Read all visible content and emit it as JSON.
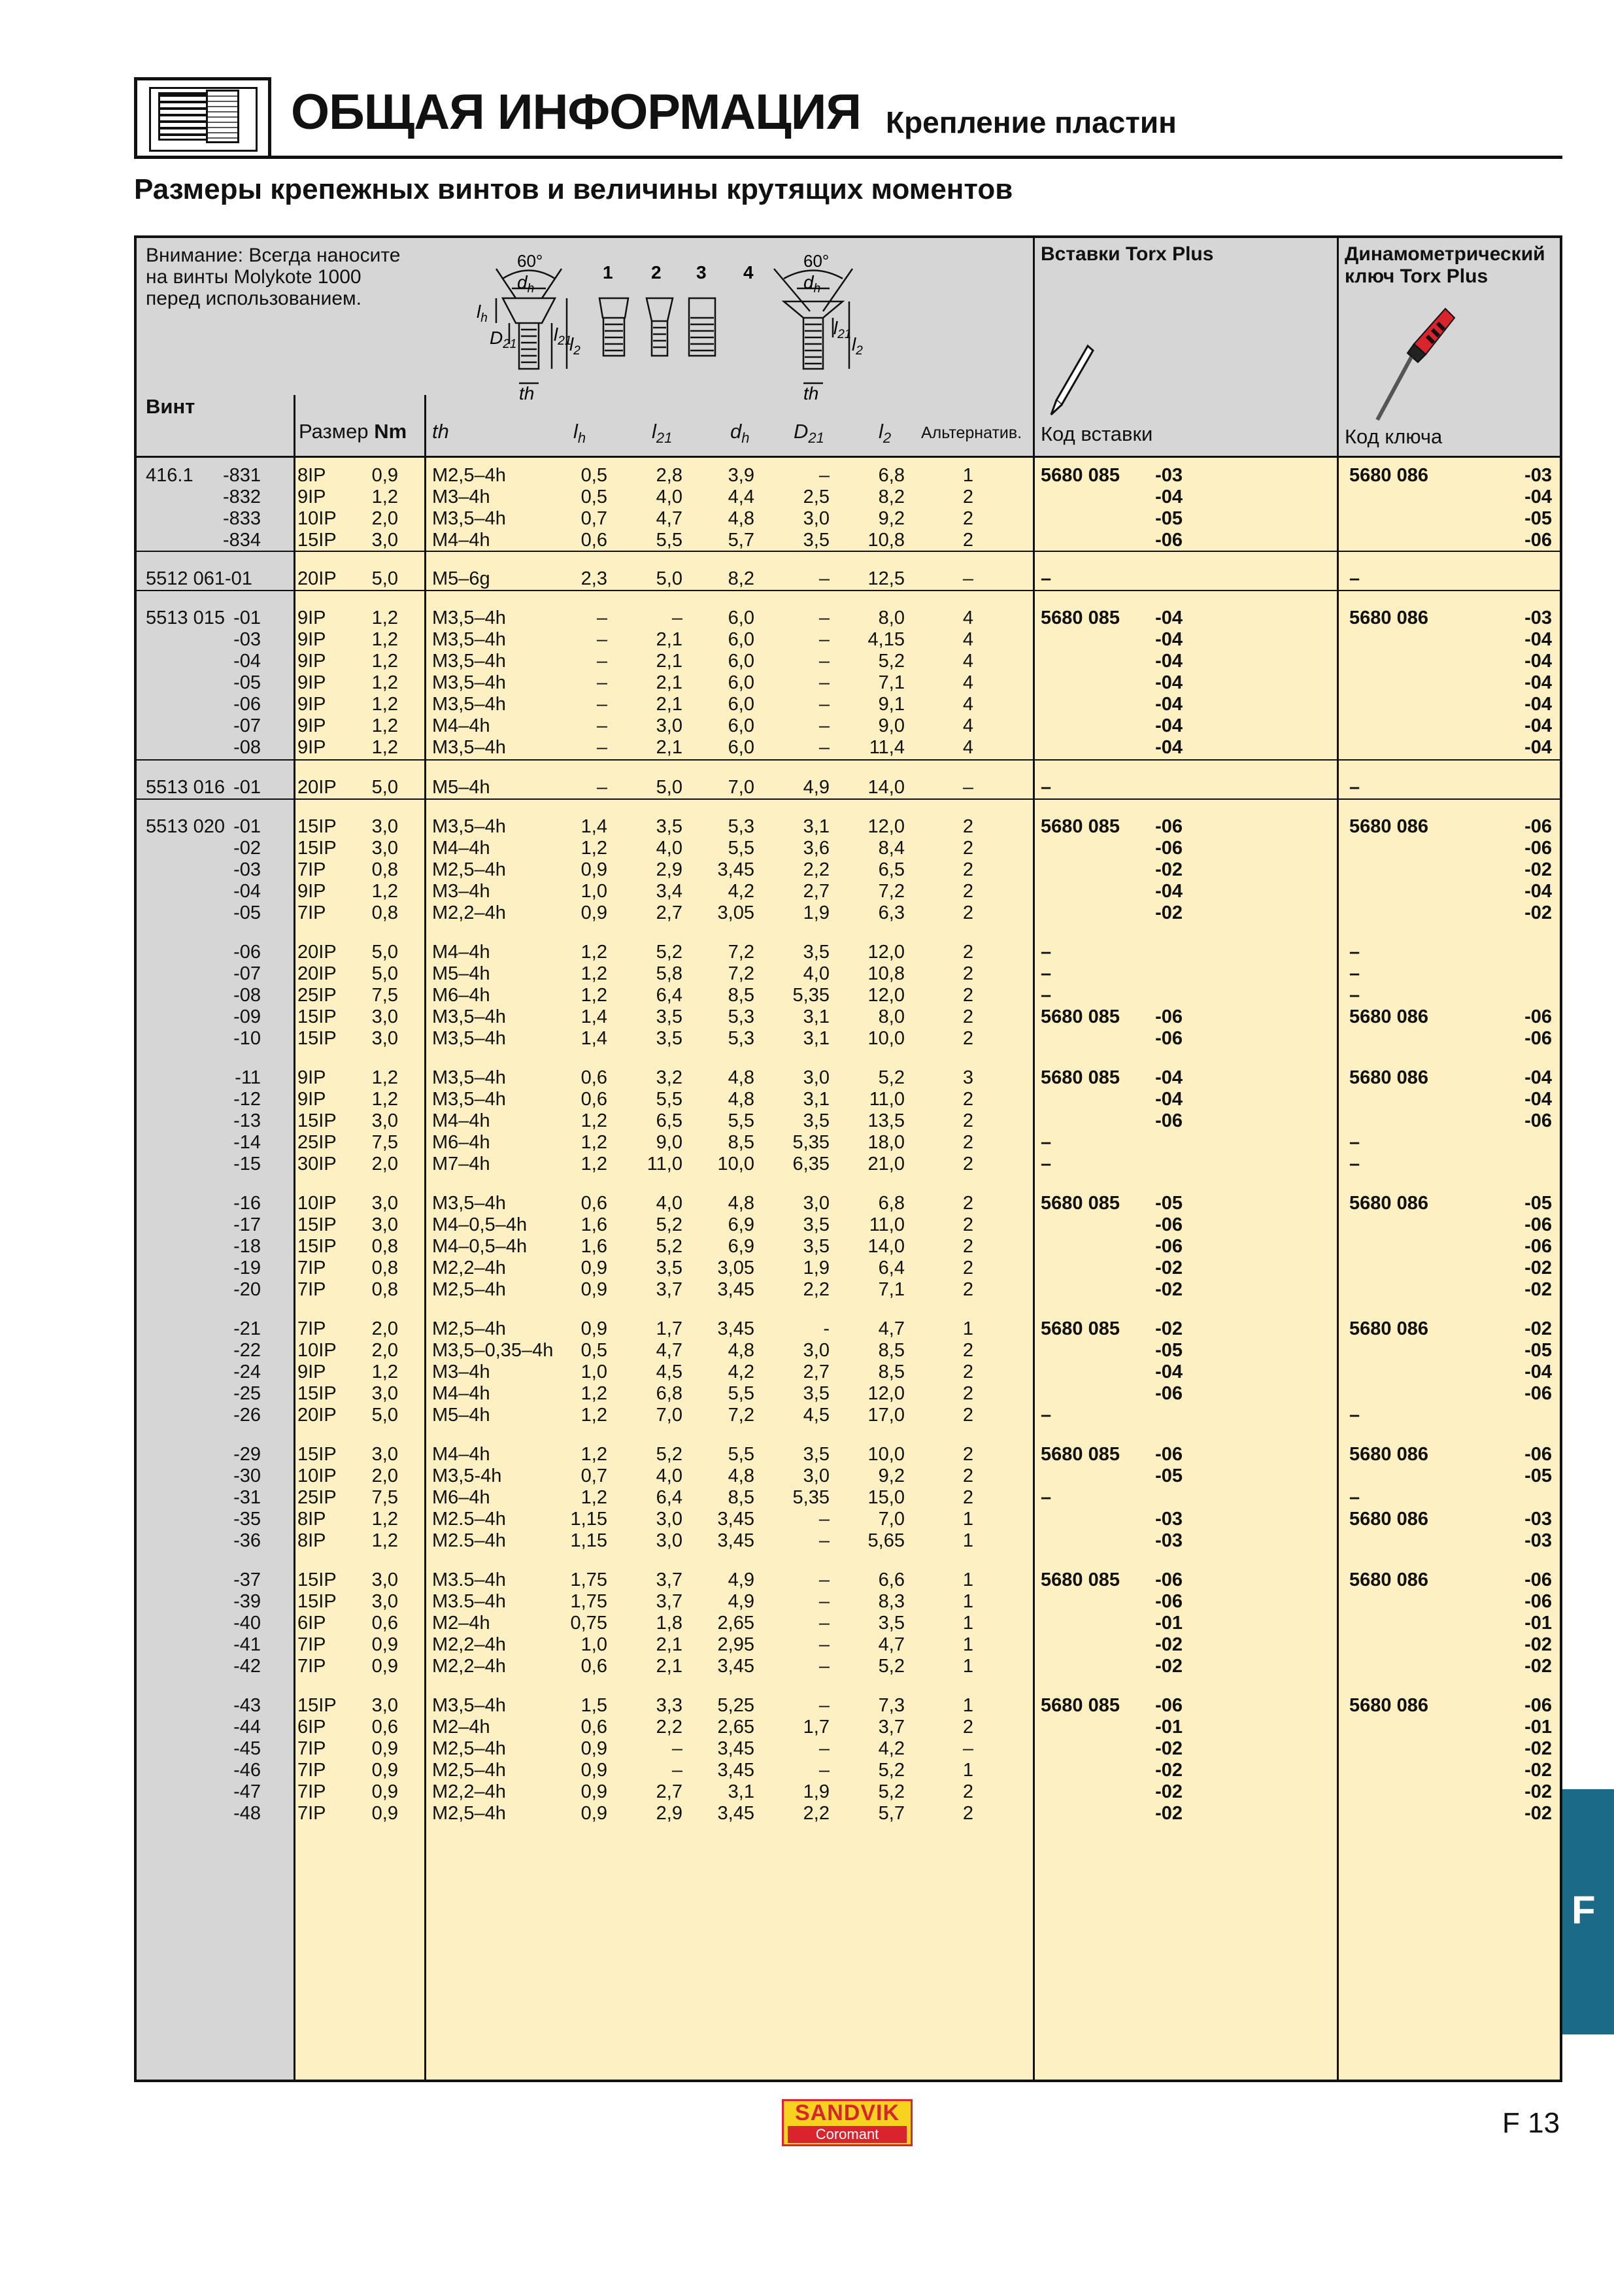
{
  "header": {
    "title": "ОБЩАЯ ИНФОРМАЦИЯ",
    "subtitle": "Крепление пластин"
  },
  "section_title": "Размеры крепежных винтов и величины крутящих моментов",
  "table_head": {
    "note": [
      "Внимание: Всегда наносите",
      "на винты Molykote 1000",
      "перед использованием."
    ],
    "screw": "Винт",
    "size": "Размер",
    "nm": "Nm",
    "th": "th",
    "lh": "l",
    "lh_sub": "h",
    "l21": "l",
    "l21_sub": "21",
    "dh": "d",
    "dh_sub": "h",
    "d21": "D",
    "d21_sub": "21",
    "l2": "l",
    "l2_sub": "2",
    "alt": "Альтернатив.",
    "torx_inserts": "Вставки Torx Plus",
    "torque_key": [
      "Динамометрический",
      "ключ Torx Plus"
    ],
    "insert_code": "Код вставки",
    "key_code": "Код ключа",
    "diagram": {
      "angle": "60°",
      "type_numbers": [
        "1",
        "2",
        "3",
        "4"
      ],
      "lbl_dh": "d",
      "lbl_dh_sub": "h",
      "lbl_lh": "l",
      "lbl_lh_sub": "h",
      "lbl_D21": "D",
      "lbl_D21_sub": "21",
      "lbl_l21": "l",
      "lbl_l21_sub": "21",
      "lbl_l2": "l",
      "lbl_l2_sub": "2",
      "lbl_th": "th"
    }
  },
  "rows": [
    [
      "416.1",
      "-831",
      "8IP",
      "0,9",
      "M2,5–4h",
      "0,5",
      "2,8",
      "3,9",
      "–",
      "6,8",
      "1",
      "5680 085",
      "-03",
      "5680 086",
      "-03"
    ],
    [
      "",
      "-832",
      "9IP",
      "1,2",
      "M3–4h",
      "0,5",
      "4,0",
      "4,4",
      "2,5",
      "8,2",
      "2",
      "",
      "-04",
      "",
      "-04"
    ],
    [
      "",
      "-833",
      "10IP",
      "2,0",
      "M3,5–4h",
      "0,7",
      "4,7",
      "4,8",
      "3,0",
      "9,2",
      "2",
      "",
      "-05",
      "",
      "-05"
    ],
    [
      "",
      "-834",
      "15IP",
      "3,0",
      "M4–4h",
      "0,6",
      "5,5",
      "5,7",
      "3,5",
      "10,8",
      "2",
      "",
      "-06",
      "",
      "-06"
    ],
    [
      "5512 061-01",
      "",
      "20IP",
      "5,0",
      "M5–6g",
      "2,3",
      "5,0",
      "8,2",
      "–",
      "12,5",
      "–",
      "–",
      "",
      "–",
      ""
    ],
    [
      "5513 015",
      "-01",
      "9IP",
      "1,2",
      "M3,5–4h",
      "–",
      "–",
      "6,0",
      "–",
      "8,0",
      "4",
      "5680 085",
      "-04",
      "5680 086",
      "-03"
    ],
    [
      "",
      "-03",
      "9IP",
      "1,2",
      "M3,5–4h",
      "–",
      "2,1",
      "6,0",
      "–",
      "4,15",
      "4",
      "",
      "-04",
      "",
      "-04"
    ],
    [
      "",
      "-04",
      "9IP",
      "1,2",
      "M3,5–4h",
      "–",
      "2,1",
      "6,0",
      "–",
      "5,2",
      "4",
      "",
      "-04",
      "",
      "-04"
    ],
    [
      "",
      "-05",
      "9IP",
      "1,2",
      "M3,5–4h",
      "–",
      "2,1",
      "6,0",
      "–",
      "7,1",
      "4",
      "",
      "-04",
      "",
      "-04"
    ],
    [
      "",
      "-06",
      "9IP",
      "1,2",
      "M3,5–4h",
      "–",
      "2,1",
      "6,0",
      "–",
      "9,1",
      "4",
      "",
      "-04",
      "",
      "-04"
    ],
    [
      "",
      "-07",
      "9IP",
      "1,2",
      "M4–4h",
      "–",
      "3,0",
      "6,0",
      "–",
      "9,0",
      "4",
      "",
      "-04",
      "",
      "-04"
    ],
    [
      "",
      "-08",
      "9IP",
      "1,2",
      "M3,5–4h",
      "–",
      "2,1",
      "6,0",
      "–",
      "11,4",
      "4",
      "",
      "-04",
      "",
      "-04"
    ],
    [
      "5513 016",
      "-01",
      "20IP",
      "5,0",
      "M5–4h",
      "–",
      "5,0",
      "7,0",
      "4,9",
      "14,0",
      "–",
      "–",
      "",
      "–",
      ""
    ],
    [
      "5513 020",
      "-01",
      "15IP",
      "3,0",
      "M3,5–4h",
      "1,4",
      "3,5",
      "5,3",
      "3,1",
      "12,0",
      "2",
      "5680 085",
      "-06",
      "5680 086",
      "-06"
    ],
    [
      "",
      "-02",
      "15IP",
      "3,0",
      "M4–4h",
      "1,2",
      "4,0",
      "5,5",
      "3,6",
      "8,4",
      "2",
      "",
      "-06",
      "",
      "-06"
    ],
    [
      "",
      "-03",
      "7IP",
      "0,8",
      "M2,5–4h",
      "0,9",
      "2,9",
      "3,45",
      "2,2",
      "6,5",
      "2",
      "",
      "-02",
      "",
      "-02"
    ],
    [
      "",
      "-04",
      "9IP",
      "1,2",
      "M3–4h",
      "1,0",
      "3,4",
      "4,2",
      "2,7",
      "7,2",
      "2",
      "",
      "-04",
      "",
      "-04"
    ],
    [
      "",
      "-05",
      "7IP",
      "0,8",
      "M2,2–4h",
      "0,9",
      "2,7",
      "3,05",
      "1,9",
      "6,3",
      "2",
      "",
      "-02",
      "",
      "-02"
    ],
    [
      "",
      "-06",
      "20IP",
      "5,0",
      "M4–4h",
      "1,2",
      "5,2",
      "7,2",
      "3,5",
      "12,0",
      "2",
      "–",
      "",
      "–",
      ""
    ],
    [
      "",
      "-07",
      "20IP",
      "5,0",
      "M5–4h",
      "1,2",
      "5,8",
      "7,2",
      "4,0",
      "10,8",
      "2",
      "–",
      "",
      "–",
      ""
    ],
    [
      "",
      "-08",
      "25IP",
      "7,5",
      "M6–4h",
      "1,2",
      "6,4",
      "8,5",
      "5,35",
      "12,0",
      "2",
      "–",
      "",
      "–",
      ""
    ],
    [
      "",
      "-09",
      "15IP",
      "3,0",
      "M3,5–4h",
      "1,4",
      "3,5",
      "5,3",
      "3,1",
      "8,0",
      "2",
      "5680 085",
      "-06",
      "5680 086",
      "-06"
    ],
    [
      "",
      "-10",
      "15IP",
      "3,0",
      "M3,5–4h",
      "1,4",
      "3,5",
      "5,3",
      "3,1",
      "10,0",
      "2",
      "",
      "-06",
      "",
      "-06"
    ],
    [
      "",
      "-11",
      "9IP",
      "1,2",
      "M3,5–4h",
      "0,6",
      "3,2",
      "4,8",
      "3,0",
      "5,2",
      "3",
      "5680 085",
      "-04",
      "5680 086",
      "-04"
    ],
    [
      "",
      "-12",
      "9IP",
      "1,2",
      "M3,5–4h",
      "0,6",
      "5,5",
      "4,8",
      "3,1",
      "11,0",
      "2",
      "",
      "-04",
      "",
      "-04"
    ],
    [
      "",
      "-13",
      "15IP",
      "3,0",
      "M4–4h",
      "1,2",
      "6,5",
      "5,5",
      "3,5",
      "13,5",
      "2",
      "",
      "-06",
      "",
      "-06"
    ],
    [
      "",
      "-14",
      "25IP",
      "7,5",
      "M6–4h",
      "1,2",
      "9,0",
      "8,5",
      "5,35",
      "18,0",
      "2",
      "–",
      "",
      "–",
      ""
    ],
    [
      "",
      "-15",
      "30IP",
      "2,0",
      "M7–4h",
      "1,2",
      "11,0",
      "10,0",
      "6,35",
      "21,0",
      "2",
      "–",
      "",
      "–",
      ""
    ],
    [
      "",
      "-16",
      "10IP",
      "3,0",
      "M3,5–4h",
      "0,6",
      "4,0",
      "4,8",
      "3,0",
      "6,8",
      "2",
      "5680 085",
      "-05",
      "5680 086",
      "-05"
    ],
    [
      "",
      "-17",
      "15IP",
      "3,0",
      "M4–0,5–4h",
      "1,6",
      "5,2",
      "6,9",
      "3,5",
      "11,0",
      "2",
      "",
      "-06",
      "",
      "-06"
    ],
    [
      "",
      "-18",
      "15IP",
      "0,8",
      "M4–0,5–4h",
      "1,6",
      "5,2",
      "6,9",
      "3,5",
      "14,0",
      "2",
      "",
      "-06",
      "",
      "-06"
    ],
    [
      "",
      "-19",
      "7IP",
      "0,8",
      "M2,2–4h",
      "0,9",
      "3,5",
      "3,05",
      "1,9",
      "6,4",
      "2",
      "",
      "-02",
      "",
      "-02"
    ],
    [
      "",
      "-20",
      "7IP",
      "0,8",
      "M2,5–4h",
      "0,9",
      "3,7",
      "3,45",
      "2,2",
      "7,1",
      "2",
      "",
      "-02",
      "",
      "-02"
    ],
    [
      "",
      "-21",
      "7IP",
      "2,0",
      "M2,5–4h",
      "0,9",
      "1,7",
      "3,45",
      "-",
      "4,7",
      "1",
      "5680 085",
      "-02",
      "5680 086",
      "-02"
    ],
    [
      "",
      "-22",
      "10IP",
      "2,0",
      "M3,5–0,35–4h",
      "0,5",
      "4,7",
      "4,8",
      "3,0",
      "8,5",
      "2",
      "",
      "-05",
      "",
      "-05"
    ],
    [
      "",
      "-24",
      "9IP",
      "1,2",
      "M3–4h",
      "1,0",
      "4,5",
      "4,2",
      "2,7",
      "8,5",
      "2",
      "",
      "-04",
      "",
      "-04"
    ],
    [
      "",
      "-25",
      "15IP",
      "3,0",
      "M4–4h",
      "1,2",
      "6,8",
      "5,5",
      "3,5",
      "12,0",
      "2",
      "",
      "-06",
      "",
      "-06"
    ],
    [
      "",
      "-26",
      "20IP",
      "5,0",
      "M5–4h",
      "1,2",
      "7,0",
      "7,2",
      "4,5",
      "17,0",
      "2",
      "–",
      "",
      "–",
      ""
    ],
    [
      "",
      "-29",
      "15IP",
      "3,0",
      "M4–4h",
      "1,2",
      "5,2",
      "5,5",
      "3,5",
      "10,0",
      "2",
      "5680 085",
      "-06",
      "5680 086",
      "-06"
    ],
    [
      "",
      "-30",
      "10IP",
      "2,0",
      "M3,5-4h",
      "0,7",
      "4,0",
      "4,8",
      "3,0",
      "9,2",
      "2",
      "",
      "-05",
      "",
      "-05"
    ],
    [
      "",
      "-31",
      "25IP",
      "7,5",
      "M6–4h",
      "1,2",
      "6,4",
      "8,5",
      "5,35",
      "15,0",
      "2",
      "–",
      "",
      "–",
      ""
    ],
    [
      "",
      "-35",
      "8IP",
      "1,2",
      "M2.5–4h",
      "1,15",
      "3,0",
      "3,45",
      "–",
      "7,0",
      "1",
      "",
      "-03",
      "5680 086",
      "-03"
    ],
    [
      "",
      "-36",
      "8IP",
      "1,2",
      "M2.5–4h",
      "1,15",
      "3,0",
      "3,45",
      "–",
      "5,65",
      "1",
      "",
      "-03",
      "",
      "-03"
    ],
    [
      "",
      "-37",
      "15IP",
      "3,0",
      "M3.5–4h",
      "1,75",
      "3,7",
      "4,9",
      "–",
      "6,6",
      "1",
      "5680 085",
      "-06",
      "5680 086",
      "-06"
    ],
    [
      "",
      "-39",
      "15IP",
      "3,0",
      "M3.5–4h",
      "1,75",
      "3,7",
      "4,9",
      "–",
      "8,3",
      "1",
      "",
      "-06",
      "",
      "-06"
    ],
    [
      "",
      "-40",
      "6IP",
      "0,6",
      "M2–4h",
      "0,75",
      "1,8",
      "2,65",
      "–",
      "3,5",
      "1",
      "",
      "-01",
      "",
      "-01"
    ],
    [
      "",
      "-41",
      "7IP",
      "0,9",
      "M2,2–4h",
      "1,0",
      "2,1",
      "2,95",
      "–",
      "4,7",
      "1",
      "",
      "-02",
      "",
      "-02"
    ],
    [
      "",
      "-42",
      "7IP",
      "0,9",
      "M2,2–4h",
      "0,6",
      "2,1",
      "3,45",
      "–",
      "5,2",
      "1",
      "",
      "-02",
      "",
      "-02"
    ],
    [
      "",
      "-43",
      "15IP",
      "3,0",
      "M3,5–4h",
      "1,5",
      "3,3",
      "5,25",
      "–",
      "7,3",
      "1",
      "5680 085",
      "-06",
      "5680 086",
      "-06"
    ],
    [
      "",
      "-44",
      "6IP",
      "0,6",
      "M2–4h",
      "0,6",
      "2,2",
      "2,65",
      "1,7",
      "3,7",
      "2",
      "",
      "-01",
      "",
      "-01"
    ],
    [
      "",
      "-45",
      "7IP",
      "0,9",
      "M2,5–4h",
      "0,9",
      "–",
      "3,45",
      "–",
      "4,2",
      "–",
      "",
      "-02",
      "",
      "-02"
    ],
    [
      "",
      "-46",
      "7IP",
      "0,9",
      "M2,5–4h",
      "0,9",
      "–",
      "3,45",
      "–",
      "5,2",
      "1",
      "",
      "-02",
      "",
      "-02"
    ],
    [
      "",
      "-47",
      "7IP",
      "0,9",
      "M2,2–4h",
      "0,9",
      "2,7",
      "3,1",
      "1,9",
      "5,2",
      "2",
      "",
      "-02",
      "",
      "-02"
    ],
    [
      "",
      "-48",
      "7IP",
      "0,9",
      "M2,5–4h",
      "0,9",
      "2,9",
      "3,45",
      "2,2",
      "5,7",
      "2",
      "",
      "-02",
      "",
      "-02"
    ]
  ],
  "side_tab": "F",
  "logo": {
    "line1": "SANDVIK",
    "line2": "Coromant"
  },
  "page_number": "F 13",
  "colors": {
    "grey": "#d6d6d6",
    "yellow": "#fdf0c2",
    "tab_blue": "#1b6b88",
    "logo_red": "#d9232d",
    "logo_yellow": "#f7d320"
  }
}
